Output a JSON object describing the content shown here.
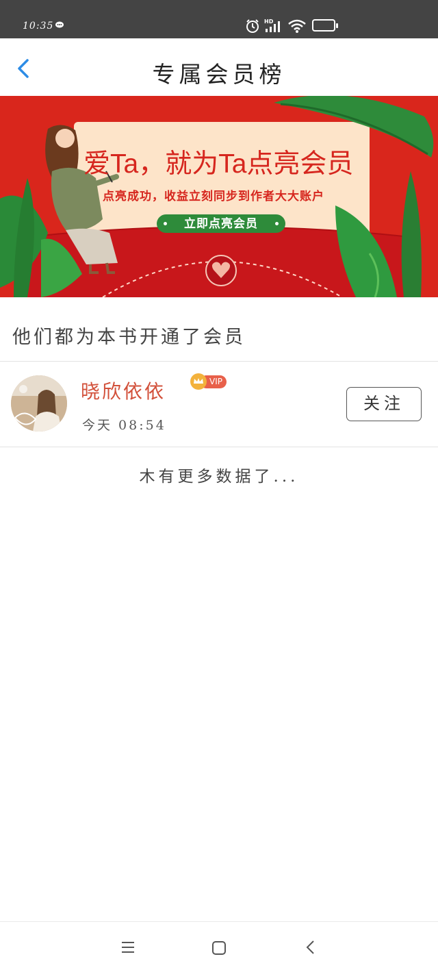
{
  "status_bar": {
    "time": "10:35",
    "network": "HD",
    "battery": "80",
    "icons": [
      "chat-icon",
      "alarm-icon",
      "signal-icon",
      "wifi-icon",
      "battery-icon"
    ]
  },
  "header": {
    "title": "专属会员榜",
    "back_icon": "chevron-left-icon",
    "accent_color": "#2d8ce6"
  },
  "banner": {
    "headline": "爱Ta，就为Ta点亮会员",
    "subtitle": "点亮成功，收益立刻同步到作者大大账户",
    "button_label": "立即点亮会员",
    "background_color": "#d9261c"
  },
  "section": {
    "title": "他们都为本书开通了会员"
  },
  "members": [
    {
      "name": "晓欣依依",
      "badge": "VIP",
      "time": "今天 08:54",
      "follow_label": "关注",
      "avatar_icon": "avatar"
    }
  ],
  "footer": {
    "no_more_text": "木有更多数据了..."
  },
  "nav_bar": {
    "icons": [
      "menu-icon",
      "home-square-icon",
      "back-triangle-icon"
    ]
  }
}
